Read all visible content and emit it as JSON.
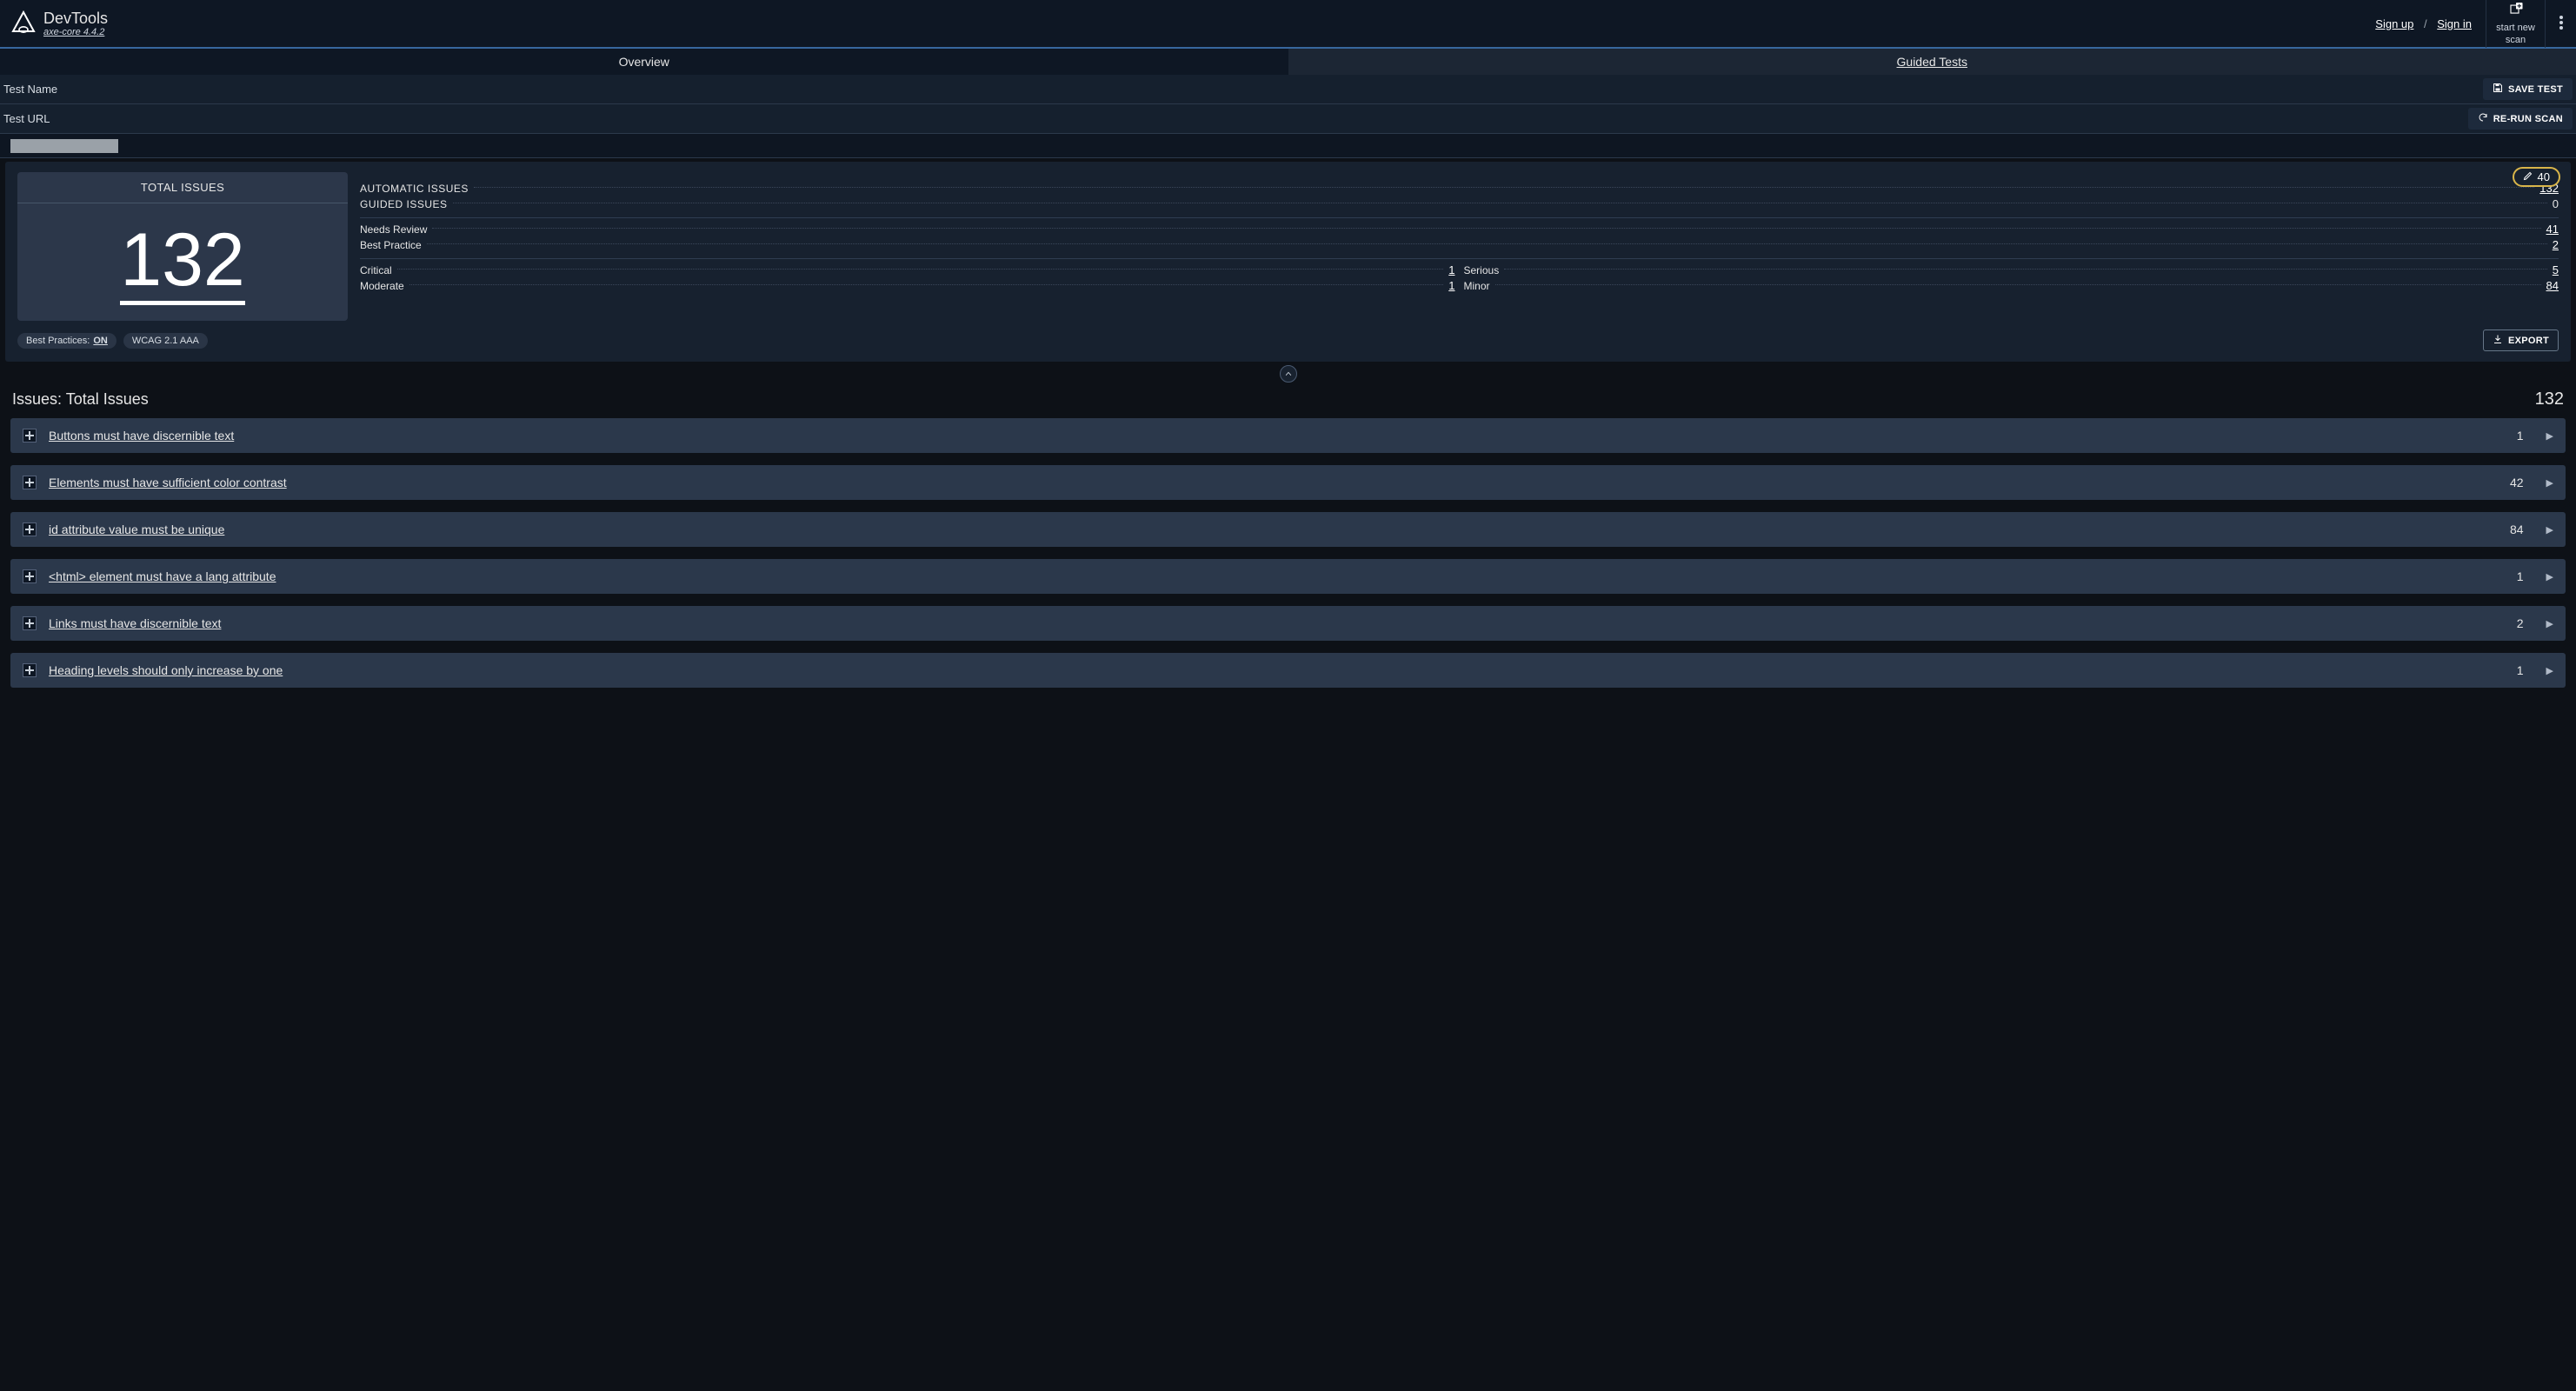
{
  "header": {
    "title": "DevTools",
    "subtitle": "axe-core 4.4.2",
    "sign_up": "Sign up",
    "sign_in": "Sign in",
    "start_new_scan_l1": "start new",
    "start_new_scan_l2": "scan"
  },
  "tabs": {
    "overview": "Overview",
    "guided": "Guided Tests"
  },
  "fields": {
    "test_name_label": "Test Name",
    "test_url_label": "Test URL",
    "save_test": "SAVE TEST",
    "rerun": "RE-RUN SCAN"
  },
  "overview": {
    "total_issues_label": "TOTAL ISSUES",
    "total_issues_value": "132",
    "highlight_count": "40",
    "rows": {
      "automatic_label": "AUTOMATIC ISSUES",
      "automatic_value": "132",
      "guided_label": "GUIDED ISSUES",
      "guided_value": "0",
      "needs_review_label": "Needs Review",
      "needs_review_value": "41",
      "best_practice_label": "Best Practice",
      "best_practice_value": "2",
      "critical_label": "Critical",
      "critical_value": "1",
      "serious_label": "Serious",
      "serious_value": "5",
      "moderate_label": "Moderate",
      "moderate_value": "1",
      "minor_label": "Minor",
      "minor_value": "84"
    },
    "pills": {
      "best_practices_prefix": "Best Practices: ",
      "best_practices_state": "ON",
      "wcag": "WCAG 2.1 AAA"
    },
    "export": "EXPORT"
  },
  "issues_header": {
    "title": "Issues: Total Issues",
    "count": "132"
  },
  "issues": [
    {
      "title": "Buttons must have discernible text",
      "count": "1"
    },
    {
      "title": "Elements must have sufficient color contrast",
      "count": "42"
    },
    {
      "title": "id attribute value must be unique",
      "count": "84"
    },
    {
      "title": "<html> element must have a lang attribute",
      "count": "1"
    },
    {
      "title": "Links must have discernible text",
      "count": "2"
    },
    {
      "title": "Heading levels should only increase by one",
      "count": "1"
    }
  ]
}
